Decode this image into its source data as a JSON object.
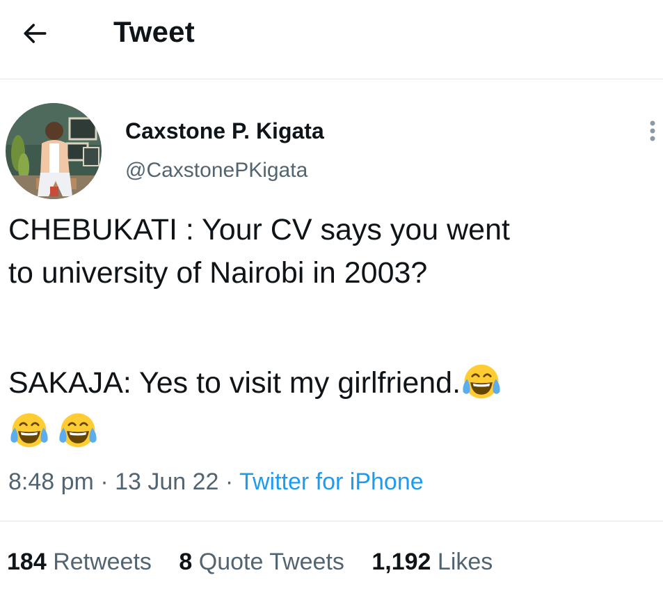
{
  "header": {
    "back_icon": "arrow-left-icon",
    "title": "Tweet"
  },
  "tweet": {
    "author": {
      "display_name": "Caxstone P. Kigata",
      "handle": "@CaxstonePKigata"
    },
    "more_icon": "more-vertical-icon",
    "text_lines": [
      "CHEBUKATI : Your CV says  you went",
      "to university of Nairobi in 2003?",
      "SAKAJA: Yes to visit my girlfriend."
    ],
    "emoji_name": "face-with-tears-of-joy",
    "time": "8:48 pm",
    "date": "13 Jun 22",
    "separator": "·",
    "source": "Twitter for iPhone"
  },
  "stats": {
    "retweets_count": "184",
    "retweets_label": "Retweets",
    "quotes_count": "8",
    "quotes_label": "Quote Tweets",
    "likes_count": "1,192",
    "likes_label": "Likes"
  },
  "colors": {
    "text_primary": "#0f1419",
    "text_secondary": "#536471",
    "link": "#1d9bf0",
    "divider": "#e3e6ea"
  }
}
